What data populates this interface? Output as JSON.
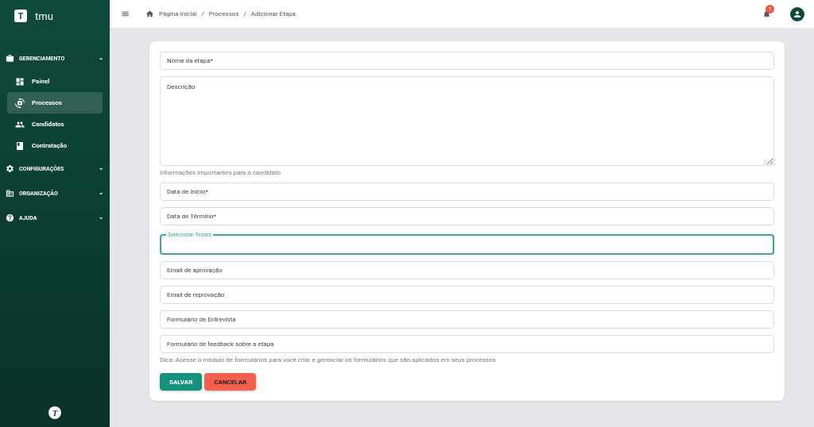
{
  "sidebar": {
    "logo": "T",
    "brand": "tmu",
    "groups": [
      {
        "label": "GERENCIAMENTO",
        "expanded": true,
        "items": [
          {
            "label": "Painel",
            "selected": false
          },
          {
            "label": "Processos",
            "selected": true
          },
          {
            "label": "Candidatos",
            "selected": false
          },
          {
            "label": "Contratação",
            "selected": false
          }
        ]
      },
      {
        "label": "CONFIGURAÇÕES",
        "expanded": false
      },
      {
        "label": "ORGANIZAÇÃO",
        "expanded": false
      },
      {
        "label": "AJUDA",
        "expanded": false
      }
    ],
    "footer_logo": "T"
  },
  "header": {
    "breadcrumb": [
      {
        "label": "Página Inicial"
      },
      {
        "separator": "/",
        "label": "Processos"
      },
      {
        "separator": "/",
        "label": "Adicionar Etapa"
      }
    ],
    "notifications": "1"
  },
  "form": {
    "fields": [
      {
        "kind": "input",
        "placeholder": "Nome da etapa*"
      },
      {
        "kind": "textarea",
        "placeholder": "Descrição",
        "helper": "Informações importantes para o candidato"
      },
      {
        "kind": "input",
        "placeholder": "Data de Início*"
      },
      {
        "kind": "input",
        "placeholder": "Data de Término*"
      },
      {
        "kind": "select",
        "label": "Selecionar Testes",
        "focused": true
      },
      {
        "kind": "input",
        "placeholder": "Email de aprovação"
      },
      {
        "kind": "input",
        "placeholder": "Email de reprovação"
      },
      {
        "kind": "input",
        "placeholder": "Formulário de Entrevista"
      },
      {
        "kind": "input",
        "placeholder": "Formulário de feedback sobre a etapa",
        "helper": "Dica: Acesse o módulo de formulários para você criar e gerenciar os formulários que são aplicados em seus processos"
      }
    ],
    "buttons": [
      {
        "kind": "primary",
        "label": "SALVAR"
      },
      {
        "kind": "danger",
        "label": "CANCELAR"
      }
    ]
  }
}
